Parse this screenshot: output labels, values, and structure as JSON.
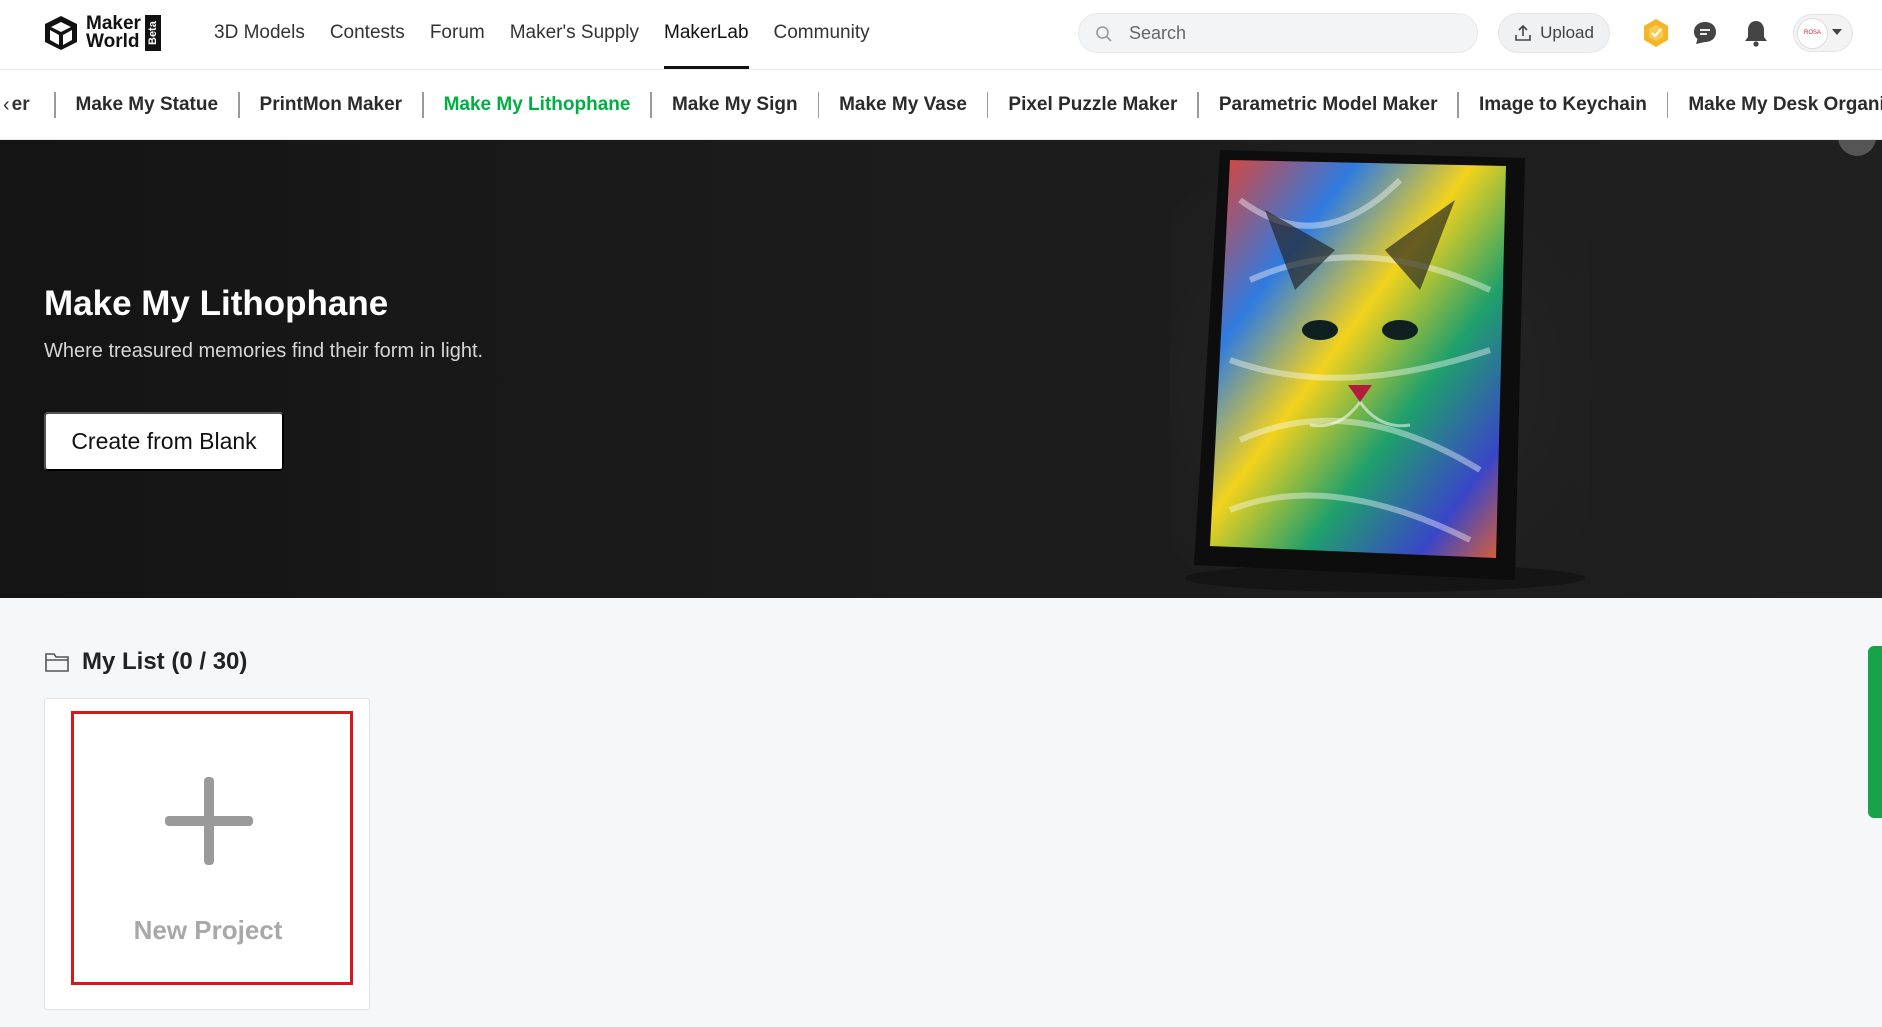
{
  "header": {
    "logo": {
      "line1": "Maker",
      "line2": "World",
      "badge": "Beta"
    },
    "nav": [
      {
        "label": "3D Models"
      },
      {
        "label": "Contests"
      },
      {
        "label": "Forum"
      },
      {
        "label": "Maker's Supply"
      },
      {
        "label": "MakerLab",
        "active": true
      },
      {
        "label": "Community"
      }
    ],
    "search": {
      "placeholder": "Search",
      "value": ""
    },
    "upload_label": "Upload",
    "icons": [
      "points-badge-icon",
      "message-icon",
      "bell-icon"
    ],
    "avatar_text": "ROSA"
  },
  "subnav": {
    "prev_icon": "chevron-left-icon",
    "truncated_fragment": "er",
    "items": [
      {
        "label": "Make My Statue"
      },
      {
        "label": "PrintMon Maker"
      },
      {
        "label": "Make My Lithophane",
        "active": true
      },
      {
        "label": "Make My Sign"
      },
      {
        "label": "Make My Vase"
      },
      {
        "label": "Pixel Puzzle Maker"
      },
      {
        "label": "Parametric Model Maker"
      },
      {
        "label": "Image to Keychain"
      },
      {
        "label": "Make My Desk Organizer"
      }
    ],
    "active_color": "#00ae42"
  },
  "hero": {
    "title": "Make My Lithophane",
    "subtitle": "Where treasured memories find their form in light.",
    "button_label": "Create from Blank"
  },
  "my_list": {
    "title": "My List (0 / 30)",
    "new_project_label": "New Project",
    "highlight_color": "#d9161b"
  }
}
